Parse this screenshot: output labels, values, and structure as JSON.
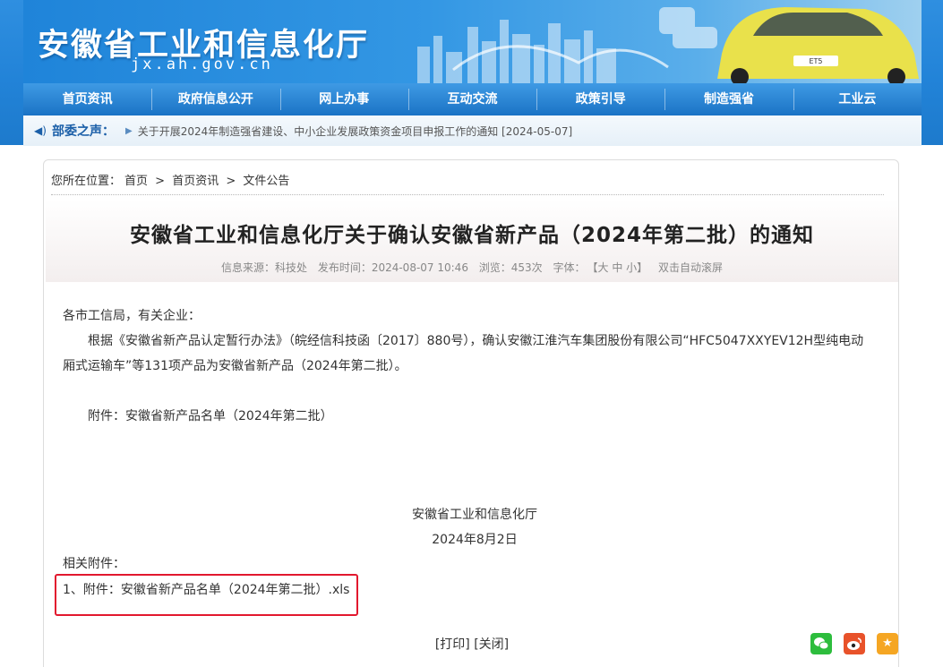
{
  "header": {
    "title": "安徽省工业和信息化厅",
    "domain": "jx.ah.gov.cn",
    "car_plate": "ET5"
  },
  "nav": {
    "items": [
      "首页资讯",
      "政府信息公开",
      "网上办事",
      "互动交流",
      "政策引导",
      "制造强省",
      "工业云"
    ]
  },
  "notice": {
    "label": "部委之声：",
    "text": "关于开展2024年制造强省建设、中小企业发展政策资金项目申报工作的通知 [2024-05-07]"
  },
  "breadcrumb": {
    "prefix": "您所在位置：",
    "items": [
      "首页",
      "首页资讯",
      "文件公告"
    ],
    "separator": ">"
  },
  "article": {
    "title": "安徽省工业和信息化厅关于确认安徽省新产品（2024年第二批）的通知",
    "meta": {
      "source": "信息来源：科技处",
      "time": "发布时间：2024-08-07 10:46",
      "views": "浏览：453次",
      "font_label": "字体：",
      "font_sizes": "【大 中 小】",
      "auto_scroll": "双击自动滚屏"
    },
    "salutation": "各市工信局，有关企业：",
    "para1_line1": "根据《安徽省新产品认定暂行办法》（皖经信科技函〔2017〕880号），确认安徽江淮汽车集团股份有限公司“HFC5047XXYEV12H型纯电动",
    "para1_line2": "厢式运输车”等131项产品为安徽省新产品（2024年第二批）。",
    "attachment_note": "附件：安徽省新产品名单（2024年第二批）",
    "signature_org": "安徽省工业和信息化厅",
    "signature_date": "2024年8月2日",
    "related_label": "相关附件：",
    "related_file": "1、附件：安徽省新产品名单（2024年第二批）.xls"
  },
  "actions": {
    "print": "[打印]",
    "close": "[关闭]"
  },
  "share": {
    "wechat_icon": "wechat-icon",
    "weibo_icon": "weibo-icon",
    "favorite_icon": "star-icon",
    "colors": {
      "wechat": "#2dbd3d",
      "weibo": "#e8522a",
      "favorite": "#f5a623"
    }
  }
}
